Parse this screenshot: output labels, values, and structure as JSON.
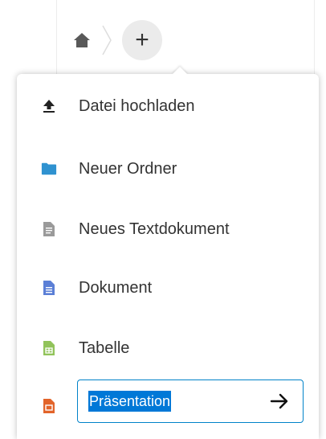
{
  "breadcrumb": {
    "home_icon": "home-icon",
    "separator_icon": "chevron-right-icon",
    "add_button_label": "+"
  },
  "menu": {
    "items": [
      {
        "label": "Datei hochladen",
        "icon": "upload-icon",
        "color": "#222222"
      },
      {
        "label": "Neuer Ordner",
        "icon": "folder-icon",
        "color": "#2f92d0"
      },
      {
        "label": "Neues Textdokument",
        "icon": "text-document-icon",
        "color": "#9a9a9a"
      },
      {
        "label": "Dokument",
        "icon": "document-icon",
        "color": "#5b7fd6"
      },
      {
        "label": "Tabelle",
        "icon": "spreadsheet-icon",
        "color": "#91c35a"
      },
      {
        "label": "",
        "icon": "presentation-icon",
        "color": "#e2642a"
      }
    ],
    "rename_input": {
      "value": "Präsentation",
      "confirm_icon": "arrow-right-icon",
      "border_color": "#0082c9",
      "selection_color": "#0078d7"
    }
  }
}
